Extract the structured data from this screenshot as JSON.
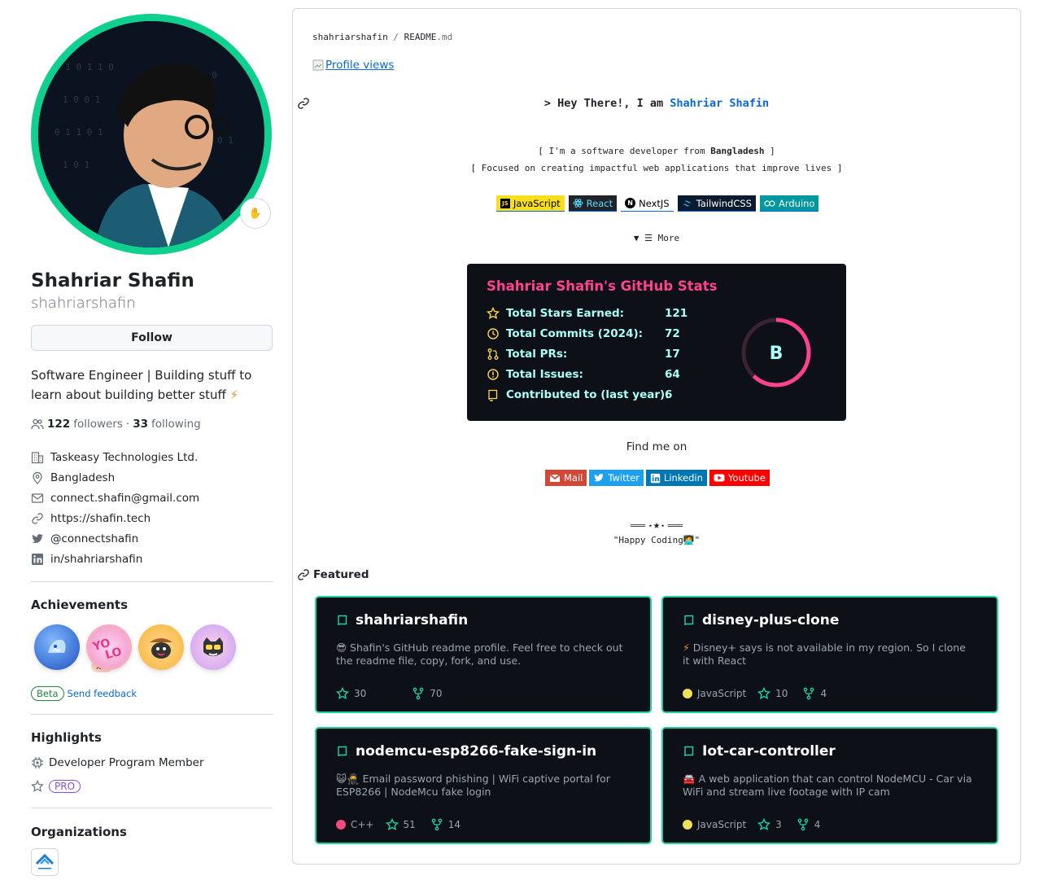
{
  "profile": {
    "name": "Shahriar Shafin",
    "login": "shahriarshafin",
    "follow_label": "Follow",
    "bio": "Software Engineer | Building stuff to learn about building better stuff",
    "bio_emoji": "⚡",
    "status_emoji": "✋",
    "followers_count": "122",
    "followers_label": "followers",
    "following_count": "33",
    "following_label": "following",
    "separator": "·",
    "company": "Taskeasy Technologies Ltd.",
    "location": "Bangladesh",
    "email": "connect.shafin@gmail.com",
    "website": "https://shafin.tech",
    "twitter": "@connectshafin",
    "linkedin": "in/shahriarshafin"
  },
  "achievements": {
    "heading": "Achievements",
    "multiplier": "x2",
    "beta_label": "Beta",
    "feedback_label": "Send feedback"
  },
  "highlights": {
    "heading": "Highlights",
    "program": "Developer Program Member",
    "pro_label": "PRO"
  },
  "organizations": {
    "heading": "Organizations"
  },
  "readme": {
    "owner": "shahriarshafin",
    "slash": "/",
    "file": "README",
    "ext": ".md",
    "profile_views_alt": "Profile views",
    "hey_prefix": "> Hey There!, I am",
    "hey_name": "Shahriar Shafin",
    "line1_prefix": "[ I'm a software developer from",
    "line1_bold": "Bangladesh",
    "line1_suffix": "]",
    "line2": "[ Focused on creating impactful web applications that improve lives ]",
    "badges": [
      {
        "label": "JavaScript",
        "bg": "#f7df1e",
        "color": "#000000"
      },
      {
        "label": "React",
        "bg": "#20232a",
        "color": "#61dafb"
      },
      {
        "label": "NextJS",
        "bg": "#ffffff",
        "color": "#000000"
      },
      {
        "label": "TailwindCSS",
        "bg": "#0b1a2e",
        "color": "#ffffff"
      },
      {
        "label": "Arduino",
        "bg": "#00979d",
        "color": "#ffffff"
      }
    ],
    "more_label": "☰ More",
    "find_me": "Find me on",
    "social": [
      {
        "label": "Mail",
        "bg": "#d14836"
      },
      {
        "label": "Twitter",
        "bg": "#1ca1f1"
      },
      {
        "label": "Linkedin",
        "bg": "#0077b5"
      },
      {
        "label": "Youtube",
        "bg": "#ff0000"
      }
    ],
    "divider": "═══ ⋆★⋆ ═══",
    "happy": "\"Happy Coding🧑‍💻\""
  },
  "stats": {
    "title": "Shahriar Shafin's GitHub Stats",
    "rows": [
      {
        "label": "Total Stars Earned:",
        "value": "121"
      },
      {
        "label": "Total Commits (2024):",
        "value": "72"
      },
      {
        "label": "Total PRs:",
        "value": "17"
      },
      {
        "label": "Total Issues:",
        "value": "64"
      },
      {
        "label": "Contributed to (last year):",
        "value": "6"
      }
    ],
    "grade": "B",
    "grade_progress": 0.62,
    "colors": {
      "title": "#fe428e",
      "text": "#a9fef7",
      "bg": "#0d1117",
      "ring": "#fe428e"
    }
  },
  "featured": {
    "heading": "Featured",
    "cards": [
      {
        "title": "shahriarshafin",
        "emoji": "😎",
        "desc": "Shafin's GitHub readme profile. Feel free to check out the readme file, copy, fork, and use.",
        "lang": "",
        "lang_color": "",
        "stars": "30",
        "forks": "70"
      },
      {
        "title": "disney-plus-clone",
        "emoji": "⚡",
        "desc": "Disney+ says is not available in my region. So I clone it with React",
        "lang": "JavaScript",
        "lang_color": "#f1e05a",
        "stars": "10",
        "forks": "4"
      },
      {
        "title": "nodemcu-esp8266-fake-sign-in",
        "emoji": "😺🥷",
        "desc": "Email password phishing | WiFi captive portal for ESP8266 | NodeMcu fake login",
        "lang": "C++",
        "lang_color": "#f34b7d",
        "stars": "51",
        "forks": "14"
      },
      {
        "title": "Iot-car-controller",
        "emoji": "🚘",
        "desc": "A web application that can control NodeMCU - Car via WiFi and stream live footage with IP cam",
        "lang": "JavaScript",
        "lang_color": "#f1e05a",
        "stars": "3",
        "forks": "4"
      }
    ]
  }
}
